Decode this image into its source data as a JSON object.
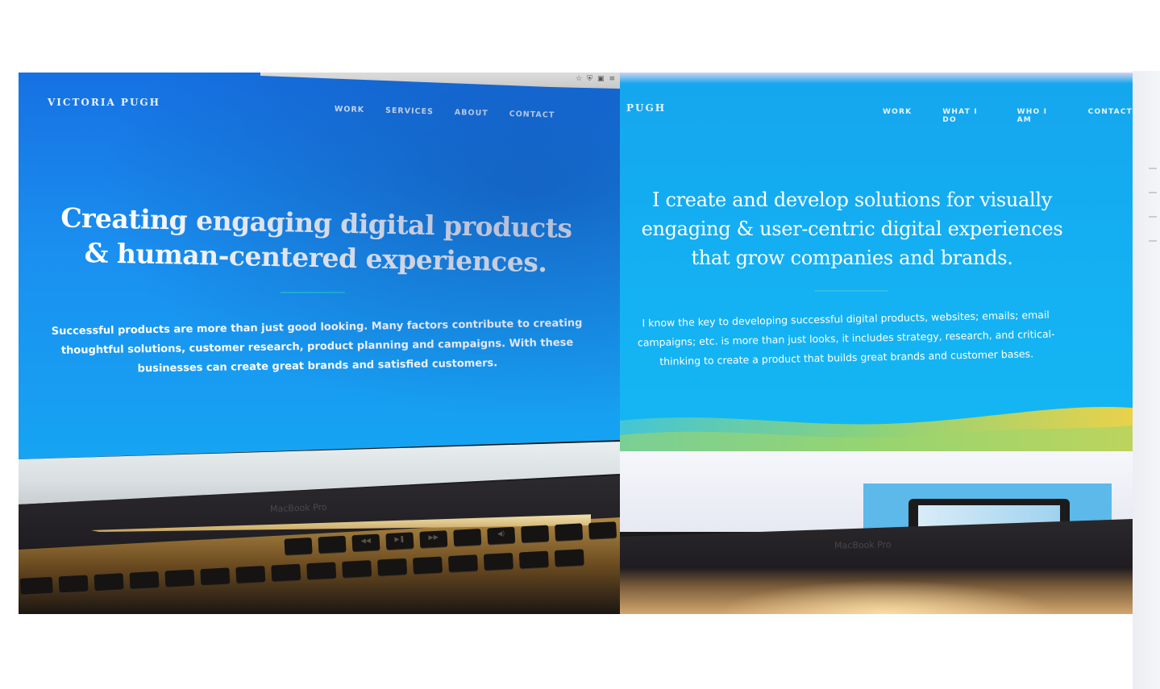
{
  "left_photo": {
    "brand": "VICTORIA PUGH",
    "nav": [
      "WORK",
      "SERVICES",
      "ABOUT",
      "CONTACT"
    ],
    "headline_line1": "Creating engaging digital products",
    "headline_line2": "& human-centered experiences.",
    "body_line1": "Successful products are more than just good looking. Many factors contribute to creating",
    "body_line2": "thoughtful solutions, customer research, product planning and campaigns. With these",
    "body_line3": "businesses can create great brands and satisfied customers.",
    "device_label": "MacBook Pro"
  },
  "right_photo": {
    "brand": "PUGH",
    "nav": [
      "WORK",
      "WHAT I DO",
      "WHO I AM",
      "CONTACT"
    ],
    "headline_line1": "I create and develop solutions for visually",
    "headline_line2": "engaging & user-centric digital experiences",
    "headline_line3": "that grow companies and brands.",
    "body_line1": "I know the key to developing successful digital products, websites; emails; email",
    "body_line2": "campaigns; etc. is more than just looks, it includes strategy, research, and critical-",
    "body_line3": "thinking to create a product that builds great brands and customer bases.",
    "device_label": "MacBook Pro"
  },
  "colors": {
    "left_screen_blue": "#1a8ff0",
    "right_screen_blue": "#14b1f3",
    "wave_yellow": "#e9d24a",
    "wave_teal": "#3fc6c8"
  },
  "icons": [
    "star-icon",
    "shield-icon",
    "extension-icon",
    "menu-icon"
  ]
}
